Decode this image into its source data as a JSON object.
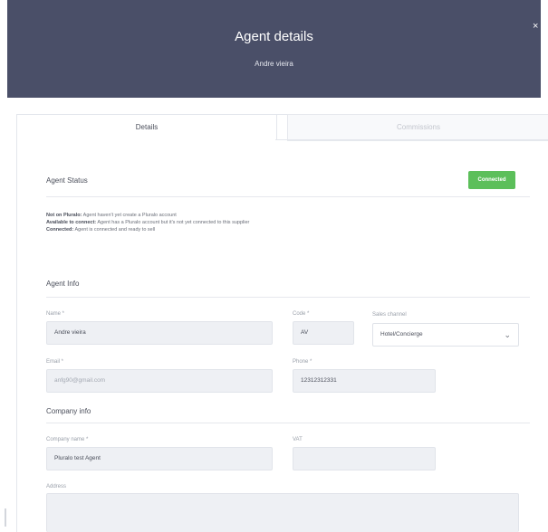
{
  "header": {
    "title": "Agent details",
    "subtitle": "Andre vieira",
    "close_glyph": "×"
  },
  "tabs": [
    {
      "label": "Details",
      "active": true
    },
    {
      "label": "Commissions",
      "active": false
    }
  ],
  "agent_status": {
    "title": "Agent Status",
    "badge": "Connected",
    "badge_color": "#5cbf5a",
    "legend": [
      {
        "term": "Not on Pluralo:",
        "desc": "Agent haven't yet create a Pluralo account"
      },
      {
        "term": "Available to connect:",
        "desc": "Agent has a Pluralo account but it's not yet connected to this supplier"
      },
      {
        "term": "Connected:",
        "desc": "Agent is connected and ready to sell"
      }
    ]
  },
  "agent_info": {
    "title": "Agent Info",
    "name": {
      "label": "Name *",
      "value": "Andre vieira"
    },
    "code": {
      "label": "Code *",
      "value": "AV"
    },
    "sales_channel": {
      "label": "Sales channel",
      "value": "Hotel/Concierge"
    },
    "email": {
      "label": "Email *",
      "value": "anfg90@gmail.com"
    },
    "phone": {
      "label": "Phone *",
      "value": "12312312331"
    }
  },
  "company_info": {
    "title": "Company info",
    "company_name": {
      "label": "Company name *",
      "value": "Pluralo test Agent"
    },
    "vat": {
      "label": "VAT",
      "value": ""
    },
    "address": {
      "label": "Address",
      "value": ""
    }
  },
  "colors": {
    "header_bg": "#4a4f68",
    "accent_green": "#5cbf5a"
  },
  "icons": {
    "close": "close-icon",
    "dropdown": "chevron-down-icon"
  }
}
